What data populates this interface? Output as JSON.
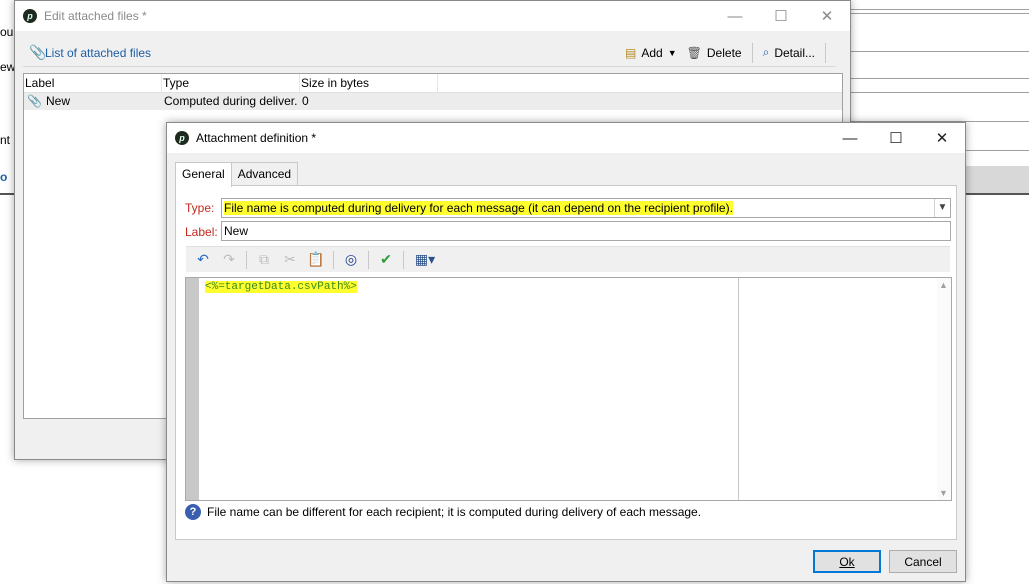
{
  "background": {
    "fragments": [
      "oul",
      "ew]",
      "nt",
      "o"
    ]
  },
  "edit_window": {
    "title": "Edit attached files *",
    "toolbar": {
      "list_title": "List of attached files",
      "add_label": "Add",
      "delete_label": "Delete",
      "detail_label": "Detail..."
    },
    "columns": [
      "Label",
      "Type",
      "Size in bytes"
    ],
    "rows": [
      {
        "label": "New",
        "type": "Computed during deliver.",
        "size": "0"
      }
    ]
  },
  "attachment_dialog": {
    "title": "Attachment definition *",
    "tabs": [
      "General",
      "Advanced"
    ],
    "active_tab": "General",
    "type_label": "Type:",
    "type_value": "File name is computed during delivery for each message (it can depend on the recipient profile).",
    "label_label": "Label:",
    "label_value": "New",
    "editor_code": "<%=targetData.csvPath%>",
    "help_text": "File name can be different for each recipient; it is computed during delivery of each message.",
    "ok_label": "Ok",
    "cancel_label": "Cancel"
  },
  "colors": {
    "highlight": "#ffff2e",
    "label_red": "#c4281c",
    "link_blue": "#1e5ea8",
    "code_green": "#3a8a1e"
  },
  "icons": [
    "app-logo-icon",
    "paperclip-icon",
    "add-icon",
    "dropdown-arrow-icon",
    "trash-icon",
    "search-icon",
    "undo-icon",
    "redo-icon",
    "copy-icon",
    "cut-icon",
    "paste-icon",
    "binoculars-icon",
    "check-icon",
    "insert-menu-icon",
    "help-icon",
    "minimize-icon",
    "maximize-icon",
    "close-icon"
  ]
}
